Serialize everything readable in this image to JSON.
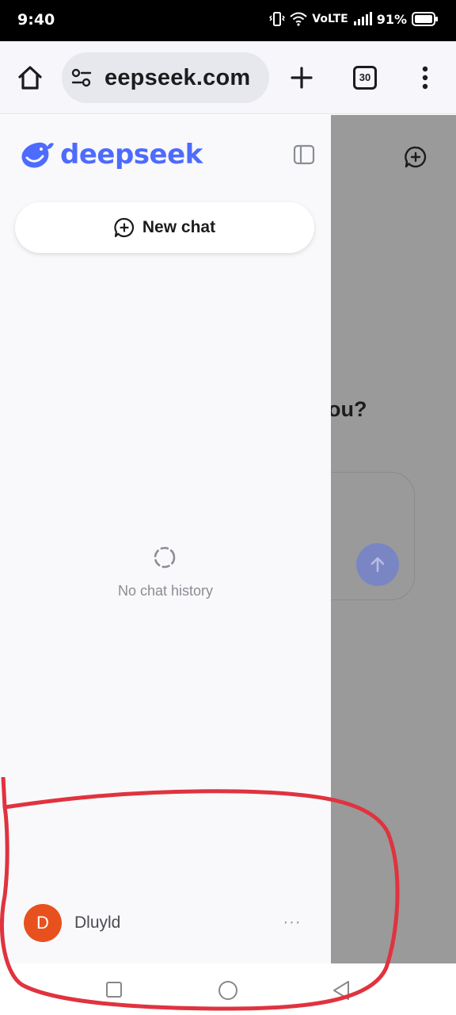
{
  "status_bar": {
    "time": "9:40",
    "network": "VoLTE",
    "battery": "91%"
  },
  "browser": {
    "url": "eepseek.com",
    "tab_count": "30",
    "icons": [
      "home-icon",
      "site-settings-icon",
      "new-tab-icon",
      "tabs-icon",
      "more-menu-icon"
    ]
  },
  "sidebar": {
    "brand": "deepseek",
    "new_chat_label": "New chat",
    "empty_state": "No chat history",
    "user": {
      "initial": "D",
      "name": "Dluyld"
    },
    "more_label": "···"
  },
  "background_page": {
    "prompt_partial": "ou?"
  },
  "colors": {
    "brand": "#4d6bfe",
    "avatar": "#e8511e",
    "annotation": "#e0333f",
    "overlay": "#9a9a9a"
  }
}
